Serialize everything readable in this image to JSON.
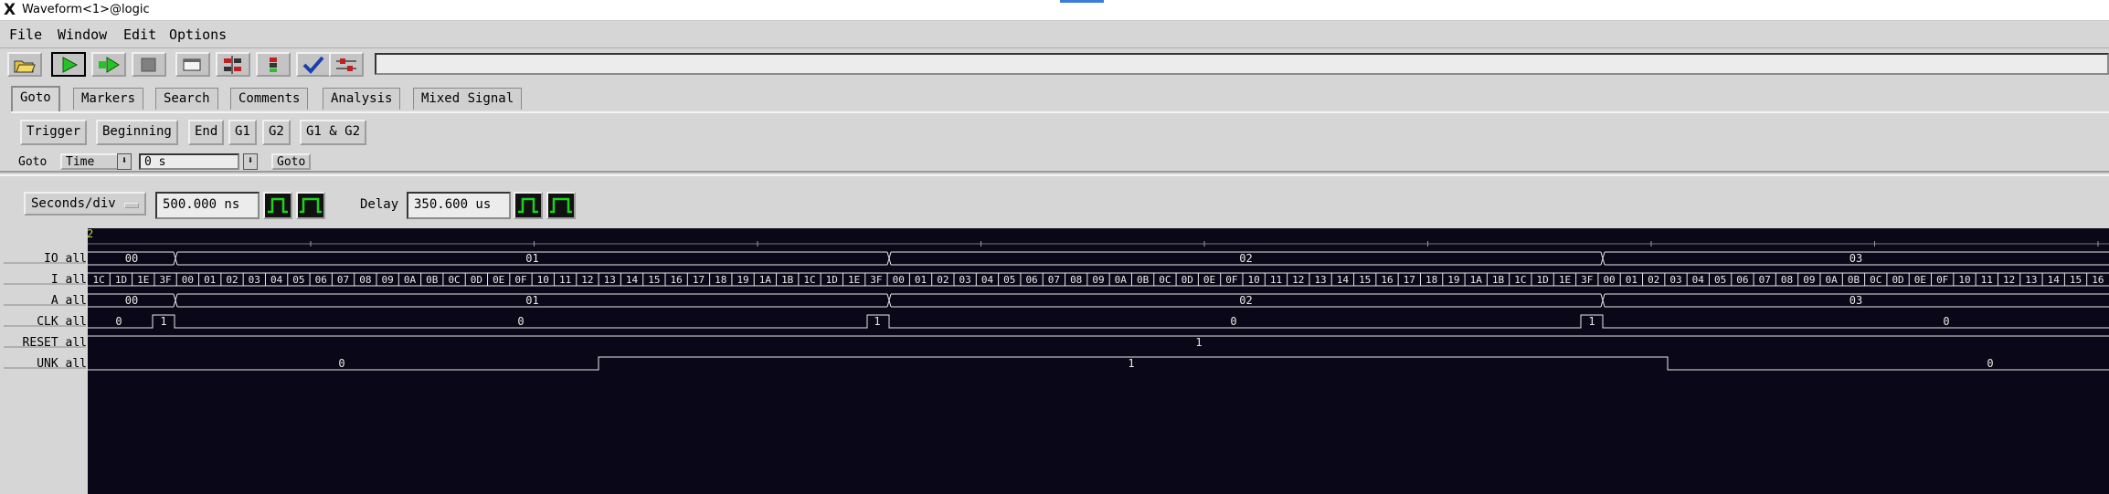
{
  "title_bar": {
    "app_glyph": "X",
    "title": "Waveform<1>@logic"
  },
  "menu": [
    "File",
    "Window",
    "Edit",
    "Options"
  ],
  "toolbar": {
    "icons": [
      "open-folder-icon",
      "run-icon",
      "run-repetitive-icon",
      "stop-icon",
      "single-window-icon",
      "ladder-icon",
      "split-icon",
      "check-icon",
      "settings-slider-icon"
    ]
  },
  "tabs": [
    "Goto",
    "Markers",
    "Search",
    "Comments",
    "Analysis",
    "Mixed Signal"
  ],
  "goto_buttons": [
    "Trigger",
    "Beginning",
    "End",
    "G1",
    "G2",
    "G1 & G2"
  ],
  "goto_row": {
    "label": "Goto",
    "mode": "Time",
    "value": "0 s",
    "button": "Goto"
  },
  "timebase": {
    "seconds_div_label": "Seconds/div",
    "seconds_div_value": "500.000 ns",
    "delay_label": "Delay",
    "delay_value": "350.600 us"
  },
  "marker_label": "2",
  "colors": {
    "background": "#0a0818",
    "trace": "#e8e8e8",
    "label_panel": "#d6d6d6",
    "icon_green": "#1dd31d"
  },
  "signals": [
    {
      "name": "IO all",
      "values": [
        "00",
        "01",
        "02",
        "03"
      ]
    },
    {
      "name": "I all",
      "values": [
        "1C",
        "1D",
        "1E",
        "3F",
        "00",
        "01",
        "02",
        "03",
        "04",
        "05",
        "06",
        "07",
        "08",
        "09",
        "0A",
        "0B",
        "0C",
        "0D",
        "0E",
        "0F",
        "10",
        "11",
        "12",
        "13",
        "14",
        "15",
        "16",
        "17",
        "18",
        "19",
        "1A",
        "1B",
        "1C",
        "1D",
        "1E",
        "3F",
        "00",
        "01",
        "02",
        "03",
        "04",
        "05",
        "06",
        "07",
        "08",
        "09",
        "0A",
        "0B",
        "0C",
        "0D",
        "0E",
        "0F",
        "10",
        "11",
        "12",
        "13",
        "14",
        "15",
        "16",
        "17",
        "18",
        "19",
        "1A",
        "1B",
        "1C",
        "1D",
        "1E",
        "3F",
        "00",
        "01",
        "02",
        "03",
        "04",
        "05",
        "06",
        "07",
        "08",
        "09",
        "0A",
        "0B",
        "0C",
        "0D",
        "0E",
        "0F",
        "10",
        "11",
        "12",
        "13",
        "14",
        "15",
        "16"
      ]
    },
    {
      "name": "A all",
      "values": [
        "00",
        "01",
        "02",
        "03"
      ]
    },
    {
      "name": "CLK all",
      "values": [
        "0",
        "1",
        "0",
        "1",
        "0",
        "1",
        "0"
      ]
    },
    {
      "name": "RESET all",
      "values": [
        "1"
      ]
    },
    {
      "name": "UNK all",
      "values": [
        "0",
        "1",
        "0"
      ]
    }
  ]
}
